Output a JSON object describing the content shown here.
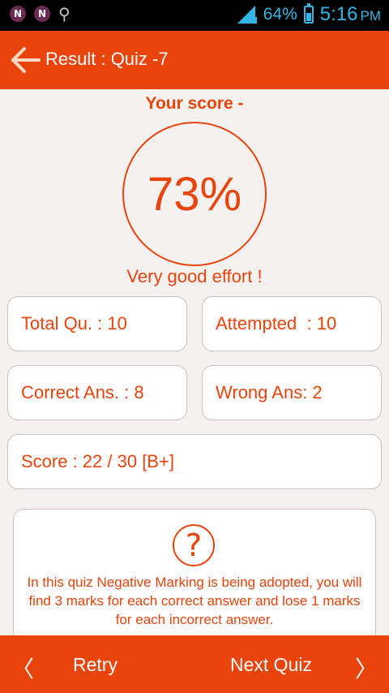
{
  "status_bar": {
    "notif_icons": [
      "N",
      "N"
    ],
    "usb_icon": "usb-icon",
    "battery_percent": "64%",
    "battery_level": 0.64,
    "time": "5:16",
    "ampm": "PM"
  },
  "header": {
    "back_icon": "arrow-left-icon",
    "title": "Result : Quiz -7"
  },
  "result": {
    "score_label": "Your score -",
    "percent": "73%",
    "remark": "Very good effort !"
  },
  "stats": {
    "total": "Total Qu. : 10",
    "attempted": "Attempted  : 10",
    "correct": "Correct Ans. : 8",
    "wrong": "Wrong Ans: 2",
    "score": "Score : 22 / 30 [B+]"
  },
  "info": {
    "icon": "question-icon",
    "symbol": "?",
    "text": "In this quiz Negative Marking is being adopted, you will find 3 marks for each correct answer and lose 1 marks for each incorrect answer."
  },
  "footer": {
    "prev_glyph": "〈",
    "retry": "Retry",
    "next_quiz": "Next Quiz",
    "next_glyph": "〉"
  },
  "colors": {
    "accent": "#e8440c",
    "background": "#f5f1f0",
    "status_text": "#33b5e5"
  }
}
